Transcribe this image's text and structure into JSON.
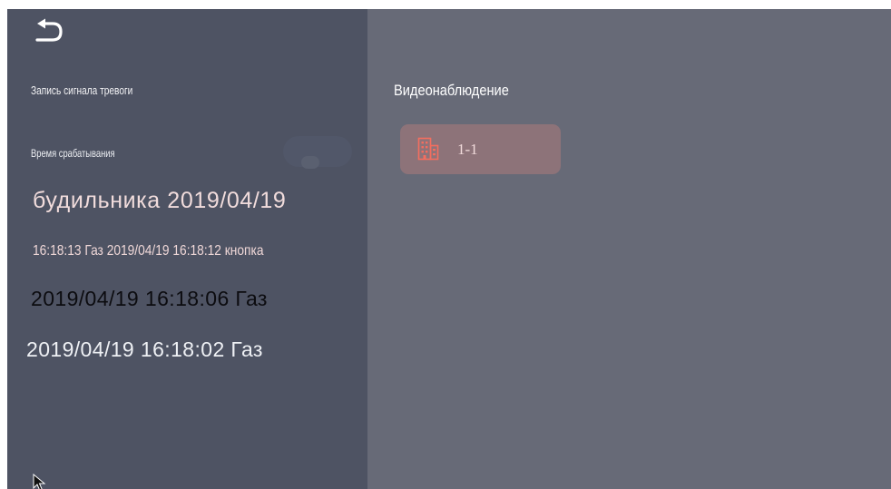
{
  "left_panel": {
    "back_icon": "back-arrow-icon",
    "record_title": "Запись сигнала тревоги",
    "trigger_time_label": "Время срабатывания",
    "alarm_lines": [
      "будильника 2019/04/19",
      "16:18:13 Газ 2019/04/19 16:18:12 кнопка",
      "2019/04/19 16:18:06 Газ",
      "2019/04/19 16:18:02 Газ"
    ]
  },
  "main": {
    "section_title": "Видеонаблюдение",
    "devices": [
      {
        "label": "1-1",
        "icon": "building-icon"
      }
    ]
  },
  "colors": {
    "left_panel_bg": "#4e5363",
    "main_bg": "#676a77",
    "tile_bg": "#8d7379",
    "icon_accent": "#f36e5f"
  }
}
